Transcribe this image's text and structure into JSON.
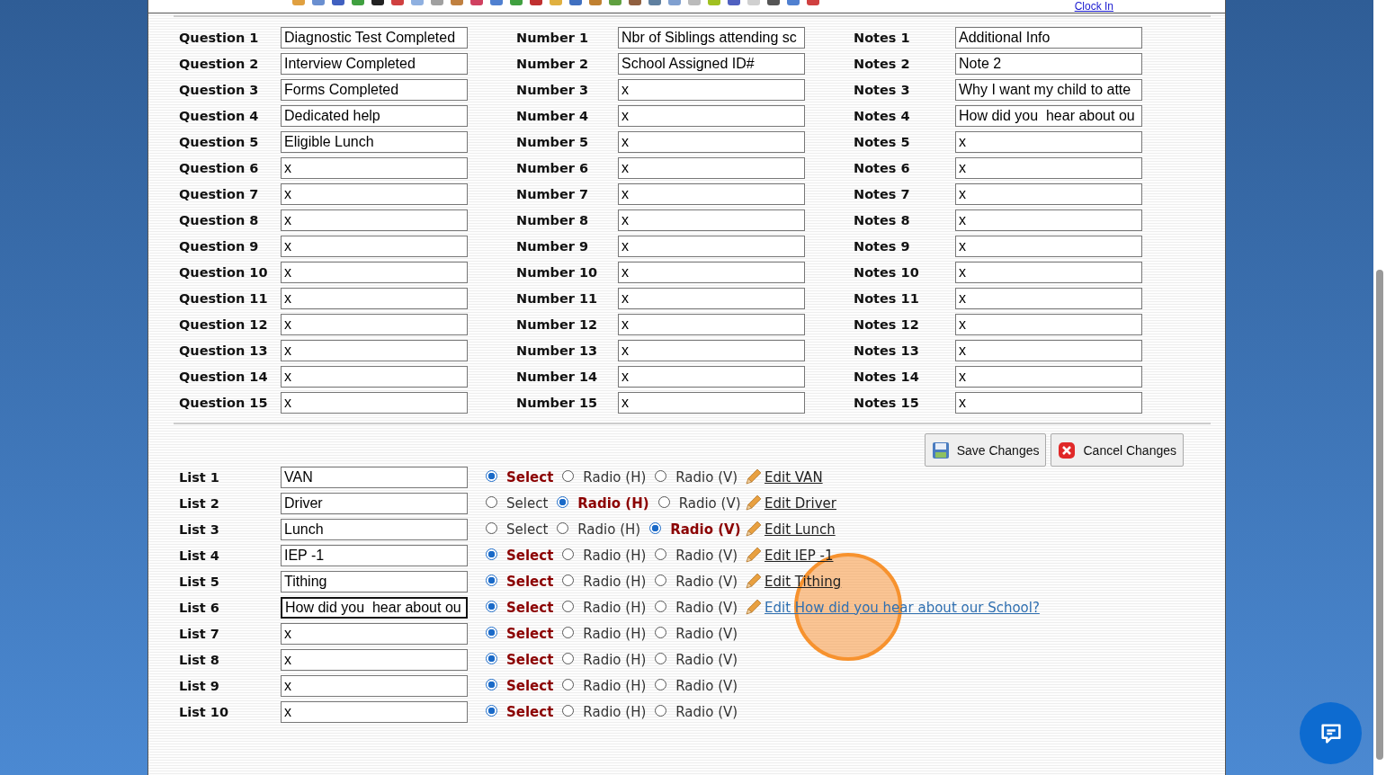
{
  "toolbar": {
    "clock_link": "Clock In"
  },
  "questions": [
    {
      "label": "Question 1",
      "value": "Diagnostic Test Completed"
    },
    {
      "label": "Question 2",
      "value": "Interview Completed"
    },
    {
      "label": "Question 3",
      "value": "Forms Completed"
    },
    {
      "label": "Question 4",
      "value": "Dedicated help"
    },
    {
      "label": "Question 5",
      "value": "Eligible Lunch"
    },
    {
      "label": "Question 6",
      "value": "x"
    },
    {
      "label": "Question 7",
      "value": "x"
    },
    {
      "label": "Question 8",
      "value": "x"
    },
    {
      "label": "Question 9",
      "value": "x"
    },
    {
      "label": "Question 10",
      "value": "x"
    },
    {
      "label": "Question 11",
      "value": "x"
    },
    {
      "label": "Question 12",
      "value": "x"
    },
    {
      "label": "Question 13",
      "value": "x"
    },
    {
      "label": "Question 14",
      "value": "x"
    },
    {
      "label": "Question 15",
      "value": "x"
    }
  ],
  "numbers": [
    {
      "label": "Number 1",
      "value": "Nbr of Siblings attending sc"
    },
    {
      "label": "Number 2",
      "value": "School Assigned ID#"
    },
    {
      "label": "Number 3",
      "value": "x"
    },
    {
      "label": "Number 4",
      "value": "x"
    },
    {
      "label": "Number 5",
      "value": "x"
    },
    {
      "label": "Number 6",
      "value": "x"
    },
    {
      "label": "Number 7",
      "value": "x"
    },
    {
      "label": "Number 8",
      "value": "x"
    },
    {
      "label": "Number 9",
      "value": "x"
    },
    {
      "label": "Number 10",
      "value": "x"
    },
    {
      "label": "Number 11",
      "value": "x"
    },
    {
      "label": "Number 12",
      "value": "x"
    },
    {
      "label": "Number 13",
      "value": "x"
    },
    {
      "label": "Number 14",
      "value": "x"
    },
    {
      "label": "Number 15",
      "value": "x"
    }
  ],
  "notes": [
    {
      "label": "Notes 1",
      "value": "Additional Info"
    },
    {
      "label": "Notes 2",
      "value": "Note 2"
    },
    {
      "label": "Notes 3",
      "value": "Why I want my child to atte"
    },
    {
      "label": "Notes 4",
      "value": "How did you  hear about ou"
    },
    {
      "label": "Notes 5",
      "value": "x"
    },
    {
      "label": "Notes 6",
      "value": "x"
    },
    {
      "label": "Notes 7",
      "value": "x"
    },
    {
      "label": "Notes 8",
      "value": "x"
    },
    {
      "label": "Notes 9",
      "value": "x"
    },
    {
      "label": "Notes 10",
      "value": "x"
    },
    {
      "label": "Notes 11",
      "value": "x"
    },
    {
      "label": "Notes 12",
      "value": "x"
    },
    {
      "label": "Notes 13",
      "value": "x"
    },
    {
      "label": "Notes 14",
      "value": "x"
    },
    {
      "label": "Notes 15",
      "value": "x"
    }
  ],
  "buttons": [
    {
      "kind": "save",
      "label": "Save Changes"
    },
    {
      "kind": "cancel",
      "label": "Cancel Changes"
    }
  ],
  "lists": [
    {
      "label": "List 1",
      "value": "VAN",
      "focused": false,
      "options": [
        {
          "label": "Select",
          "selected": true
        },
        {
          "label": "Radio (H)",
          "selected": false
        },
        {
          "label": "Radio (V)",
          "selected": false
        }
      ],
      "edit_link": "Edit VAN"
    },
    {
      "label": "List 2",
      "value": "Driver",
      "focused": false,
      "options": [
        {
          "label": "Select",
          "selected": false
        },
        {
          "label": "Radio (H)",
          "selected": true
        },
        {
          "label": "Radio (V)",
          "selected": false
        }
      ],
      "edit_link": "Edit Driver"
    },
    {
      "label": "List 3",
      "value": "Lunch",
      "focused": false,
      "options": [
        {
          "label": "Select",
          "selected": false
        },
        {
          "label": "Radio (H)",
          "selected": false
        },
        {
          "label": "Radio (V)",
          "selected": true
        }
      ],
      "edit_link": "Edit Lunch"
    },
    {
      "label": "List 4",
      "value": "IEP -1",
      "focused": false,
      "options": [
        {
          "label": "Select",
          "selected": true
        },
        {
          "label": "Radio (H)",
          "selected": false
        },
        {
          "label": "Radio (V)",
          "selected": false
        }
      ],
      "edit_link": "Edit IEP -1"
    },
    {
      "label": "List 5",
      "value": "Tithing",
      "focused": false,
      "options": [
        {
          "label": "Select",
          "selected": true
        },
        {
          "label": "Radio (H)",
          "selected": false
        },
        {
          "label": "Radio (V)",
          "selected": false
        }
      ],
      "edit_link": "Edit Tithing"
    },
    {
      "label": "List 6",
      "value": "How did you  hear about ou",
      "focused": true,
      "options": [
        {
          "label": "Select",
          "selected": true
        },
        {
          "label": "Radio (H)",
          "selected": false
        },
        {
          "label": "Radio (V)",
          "selected": false
        }
      ],
      "edit_link": "Edit How did you hear about our School?"
    },
    {
      "label": "List 7",
      "value": "x",
      "focused": false,
      "options": [
        {
          "label": "Select",
          "selected": true
        },
        {
          "label": "Radio (H)",
          "selected": false
        },
        {
          "label": "Radio (V)",
          "selected": false
        }
      ]
    },
    {
      "label": "List 8",
      "value": "x",
      "focused": false,
      "options": [
        {
          "label": "Select",
          "selected": true
        },
        {
          "label": "Radio (H)",
          "selected": false
        },
        {
          "label": "Radio (V)",
          "selected": false
        }
      ]
    },
    {
      "label": "List 9",
      "value": "x",
      "focused": false,
      "options": [
        {
          "label": "Select",
          "selected": true
        },
        {
          "label": "Radio (H)",
          "selected": false
        },
        {
          "label": "Radio (V)",
          "selected": false
        }
      ]
    },
    {
      "label": "List 10",
      "value": "x",
      "focused": false,
      "options": [
        {
          "label": "Select",
          "selected": true
        },
        {
          "label": "Radio (H)",
          "selected": false
        },
        {
          "label": "Radio (V)",
          "selected": false
        }
      ]
    }
  ]
}
